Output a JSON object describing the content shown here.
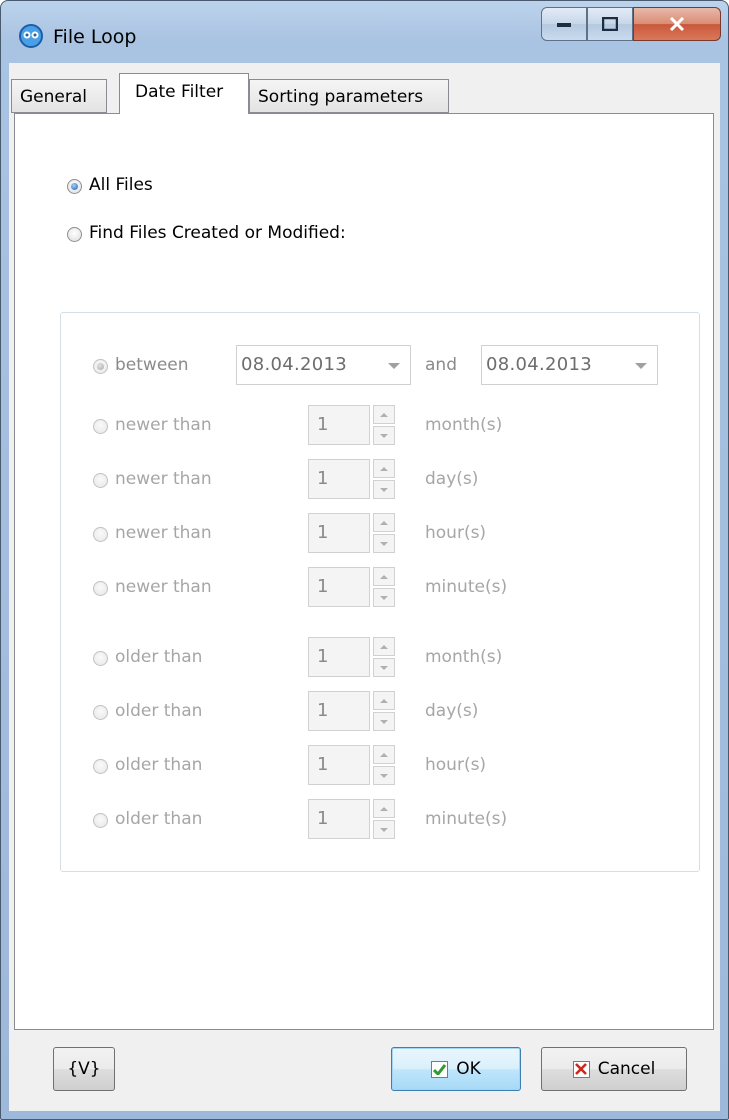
{
  "window": {
    "title": "File Loop"
  },
  "tabs": [
    {
      "label": "General"
    },
    {
      "label": "Date Filter"
    },
    {
      "label": "Sorting parameters"
    }
  ],
  "mode": {
    "all_files": "All Files",
    "find_files": "Find Files Created or Modified:"
  },
  "between": {
    "label": "between",
    "from": "08.04.2013",
    "and": "and",
    "to": "08.04.2013"
  },
  "rows": [
    {
      "label": "newer than",
      "value": "1",
      "unit": "month(s)"
    },
    {
      "label": "newer than",
      "value": "1",
      "unit": "day(s)"
    },
    {
      "label": "newer than",
      "value": "1",
      "unit": "hour(s)"
    },
    {
      "label": "newer than",
      "value": "1",
      "unit": "minute(s)"
    },
    {
      "label": "older than",
      "value": "1",
      "unit": "month(s)"
    },
    {
      "label": "older than",
      "value": "1",
      "unit": "day(s)"
    },
    {
      "label": "older than",
      "value": "1",
      "unit": "hour(s)"
    },
    {
      "label": "older than",
      "value": "1",
      "unit": "minute(s)"
    }
  ],
  "footer": {
    "variables": "{V}",
    "ok": "OK",
    "cancel": "Cancel"
  }
}
